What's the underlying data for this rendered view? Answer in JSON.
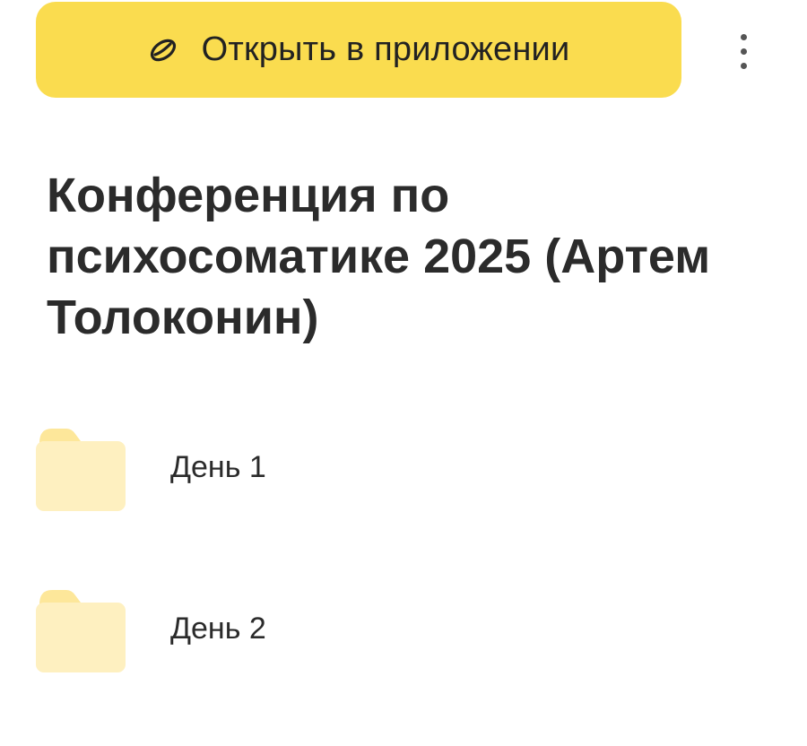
{
  "header": {
    "open_app_label": "Открыть в приложении",
    "open_app_icon": "yandex-disk-icon",
    "more_icon": "more-vertical-icon",
    "accent_color": "#fadc4f"
  },
  "page": {
    "title": "Конференция по психосоматике 2025 (Артем Толоконин)"
  },
  "folders": [
    {
      "name": "День 1",
      "icon": "folder-icon"
    },
    {
      "name": "День 2",
      "icon": "folder-icon"
    }
  ]
}
